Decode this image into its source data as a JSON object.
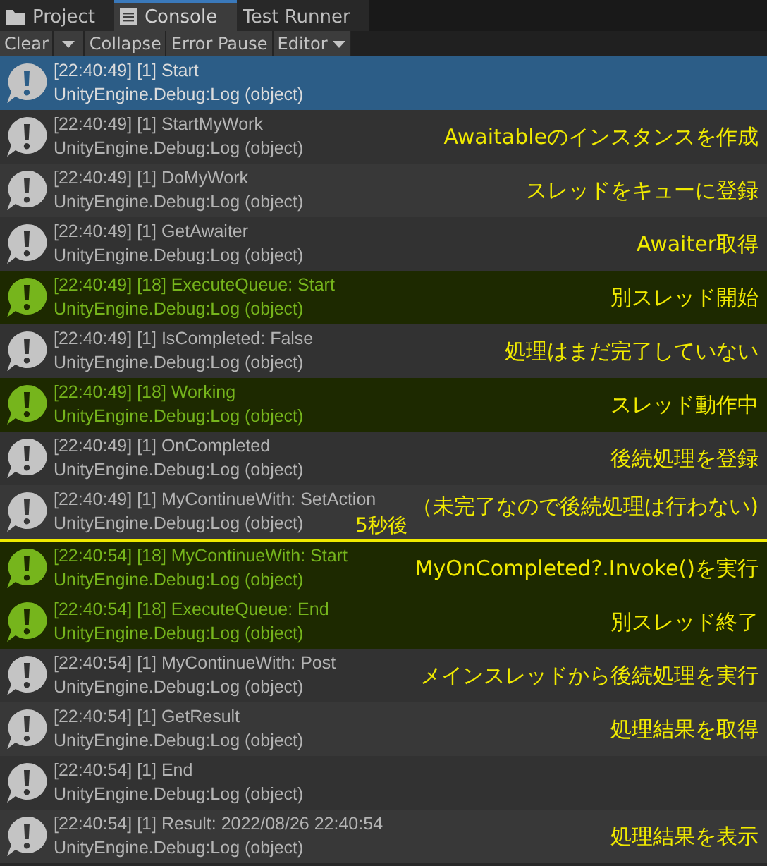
{
  "tabs": [
    {
      "label": "Project",
      "kind": "folder",
      "selected": false
    },
    {
      "label": "Console",
      "kind": "console",
      "selected": true
    },
    {
      "label": "Test Runner",
      "kind": "plain",
      "selected": false
    }
  ],
  "toolbar": [
    {
      "label": "Clear",
      "kind": "button"
    },
    {
      "kind": "caret"
    },
    {
      "label": "Collapse",
      "kind": "button"
    },
    {
      "label": "Error Pause",
      "kind": "button"
    },
    {
      "label": "Editor",
      "kind": "dropdown"
    }
  ],
  "log": [
    {
      "message": "[22:40:49] [1] Start",
      "source": "UnityEngine.Debug:Log (object)",
      "kind": "plain",
      "selected": true
    },
    {
      "message": "[22:40:49] [1] StartMyWork",
      "source": "UnityEngine.Debug:Log (object)",
      "kind": "plain",
      "selected": false,
      "annotation": "Awaitableのインスタンスを作成"
    },
    {
      "message": "[22:40:49] [1] DoMyWork",
      "source": "UnityEngine.Debug:Log (object)",
      "kind": "plain",
      "selected": false,
      "annotation": "スレッドをキューに登録"
    },
    {
      "message": "[22:40:49] [1] GetAwaiter",
      "source": "UnityEngine.Debug:Log (object)",
      "kind": "plain",
      "selected": false,
      "annotation": "Awaiter取得"
    },
    {
      "message": "[22:40:49] [18] ExecuteQueue: Start",
      "source": "UnityEngine.Debug:Log (object)",
      "kind": "green",
      "selected": false,
      "annotation": "別スレッド開始"
    },
    {
      "message": "[22:40:49] [1] IsCompleted: False",
      "source": "UnityEngine.Debug:Log (object)",
      "kind": "plain",
      "selected": false,
      "annotation": "処理はまだ完了していない"
    },
    {
      "message": "[22:40:49] [18] Working",
      "source": "UnityEngine.Debug:Log (object)",
      "kind": "green",
      "selected": false,
      "annotation": "スレッド動作中"
    },
    {
      "message": "[22:40:49] [1] OnCompleted",
      "source": "UnityEngine.Debug:Log (object)",
      "kind": "plain",
      "selected": false,
      "annotation": "後続処理を登録"
    },
    {
      "message": "[22:40:49] [1] MyContinueWith: SetAction",
      "source": "UnityEngine.Debug:Log (object)",
      "kind": "plain",
      "selected": false,
      "annotation": "（未完了なので後続処理は行わない)",
      "marker_below": "5秒後"
    },
    {
      "message": "[22:40:54] [18] MyContinueWith: Start",
      "source": "UnityEngine.Debug:Log (object)",
      "kind": "green",
      "selected": false,
      "annotation": "MyOnCompleted?.Invoke()を実行"
    },
    {
      "message": "[22:40:54] [18] ExecuteQueue: End",
      "source": "UnityEngine.Debug:Log (object)",
      "kind": "green",
      "selected": false,
      "annotation": "別スレッド終了"
    },
    {
      "message": "[22:40:54] [1] MyContinueWith: Post",
      "source": "UnityEngine.Debug:Log (object)",
      "kind": "plain",
      "selected": false,
      "annotation": "メインスレッドから後続処理を実行"
    },
    {
      "message": "[22:40:54] [1] GetResult",
      "source": "UnityEngine.Debug:Log (object)",
      "kind": "plain",
      "selected": false,
      "annotation": "処理結果を取得"
    },
    {
      "message": "[22:40:54] [1] End",
      "source": "UnityEngine.Debug:Log (object)",
      "kind": "plain",
      "selected": false
    },
    {
      "message": "[22:40:54] [1] Result: 2022/08/26 22:40:54",
      "source": "UnityEngine.Debug:Log (object)",
      "kind": "plain",
      "selected": false,
      "annotation": "処理結果を表示"
    }
  ]
}
